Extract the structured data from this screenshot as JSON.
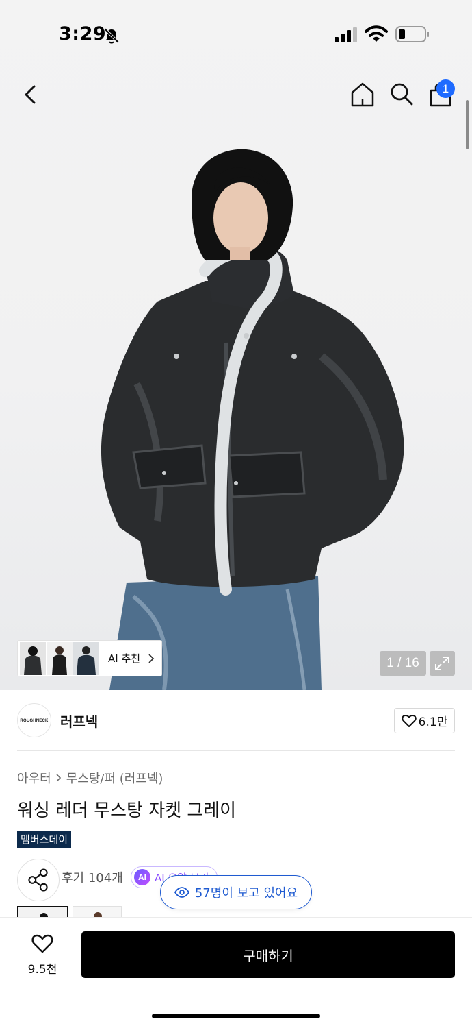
{
  "status_bar": {
    "time": "3:29"
  },
  "cart": {
    "count": "1"
  },
  "gallery": {
    "counter": "1 / 16",
    "ai_recommend_label": "AI 추천"
  },
  "brand": {
    "name": "러프넥",
    "logo_text": "ROUGHNECK",
    "likes": "6.1만"
  },
  "breadcrumb": {
    "category": "아우터",
    "subcategory": "무스탕/퍼 (러프넥)"
  },
  "product": {
    "title": "워싱 레더 무스탕 자켓 그레이",
    "badge": "멤버스데이"
  },
  "reviews": {
    "link_label": "후기 104개",
    "ai_summary_label": "AI 요약 보기",
    "ai_icon_text": "AI"
  },
  "viewers": {
    "label": "57명이 보고 있어요"
  },
  "bottom_bar": {
    "wish_count": "9.5천",
    "buy_label": "구매하기"
  },
  "colors": {
    "accent": "#1f5bd1",
    "badge_bg": "#0c2a4c",
    "cart_badge": "#1f6bff",
    "ai_purple": "#8a4dff"
  }
}
